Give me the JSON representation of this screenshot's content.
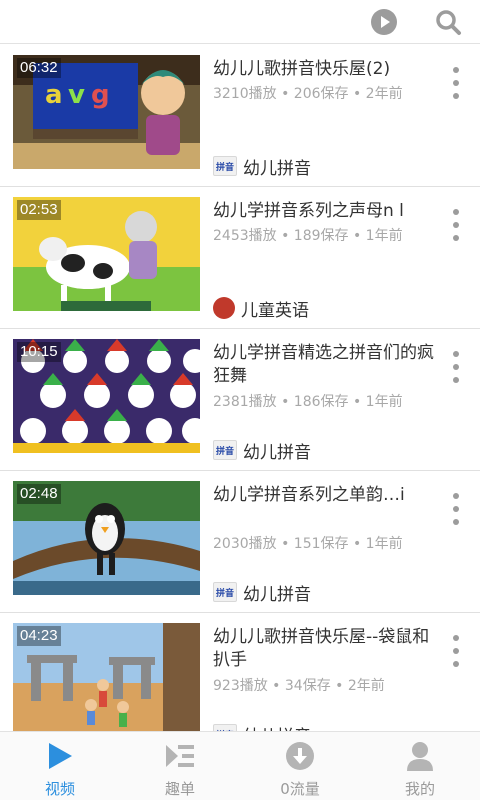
{
  "colors": {
    "accent": "#2c8fde",
    "icon_gray": "#9c9c9c",
    "meta_gray": "#a8a8a8"
  },
  "topbar": {
    "icons": [
      "play-circle-icon",
      "search-icon"
    ]
  },
  "videos": [
    {
      "duration": "06:32",
      "title": "幼儿儿歌拼音快乐屋(2)",
      "stats": "3210播放 • 206保存 • 2年前",
      "channel": "幼儿拼音",
      "channel_logo": "拼音"
    },
    {
      "duration": "02:53",
      "title": "幼儿学拼音系列之声母n l",
      "stats": "2453播放 • 189保存 • 1年前",
      "channel": "儿童英语",
      "channel_logo": ""
    },
    {
      "duration": "10:15",
      "title": "幼儿学拼音精选之拼音们的疯狂舞",
      "stats": "2381播放 • 186保存 • 1年前",
      "channel": "幼儿拼音",
      "channel_logo": "拼音"
    },
    {
      "duration": "02:48",
      "title": "幼儿学拼音系列之单韵…i",
      "stats": "2030播放 • 151保存 • 1年前",
      "channel": "幼儿拼音",
      "channel_logo": "拼音"
    },
    {
      "duration": "04:23",
      "title": "幼儿儿歌拼音快乐屋--袋鼠和扒手",
      "stats": "923播放 • 34保存 • 2年前",
      "channel": "幼儿拼音",
      "channel_logo": "拼音"
    }
  ],
  "tabs": [
    {
      "label": "视频",
      "icon": "video-play-icon",
      "active": true
    },
    {
      "label": "趣单",
      "icon": "playlist-icon",
      "active": false
    },
    {
      "label": "0流量",
      "icon": "download-icon",
      "active": false
    },
    {
      "label": "我的",
      "icon": "profile-icon",
      "active": false
    }
  ]
}
